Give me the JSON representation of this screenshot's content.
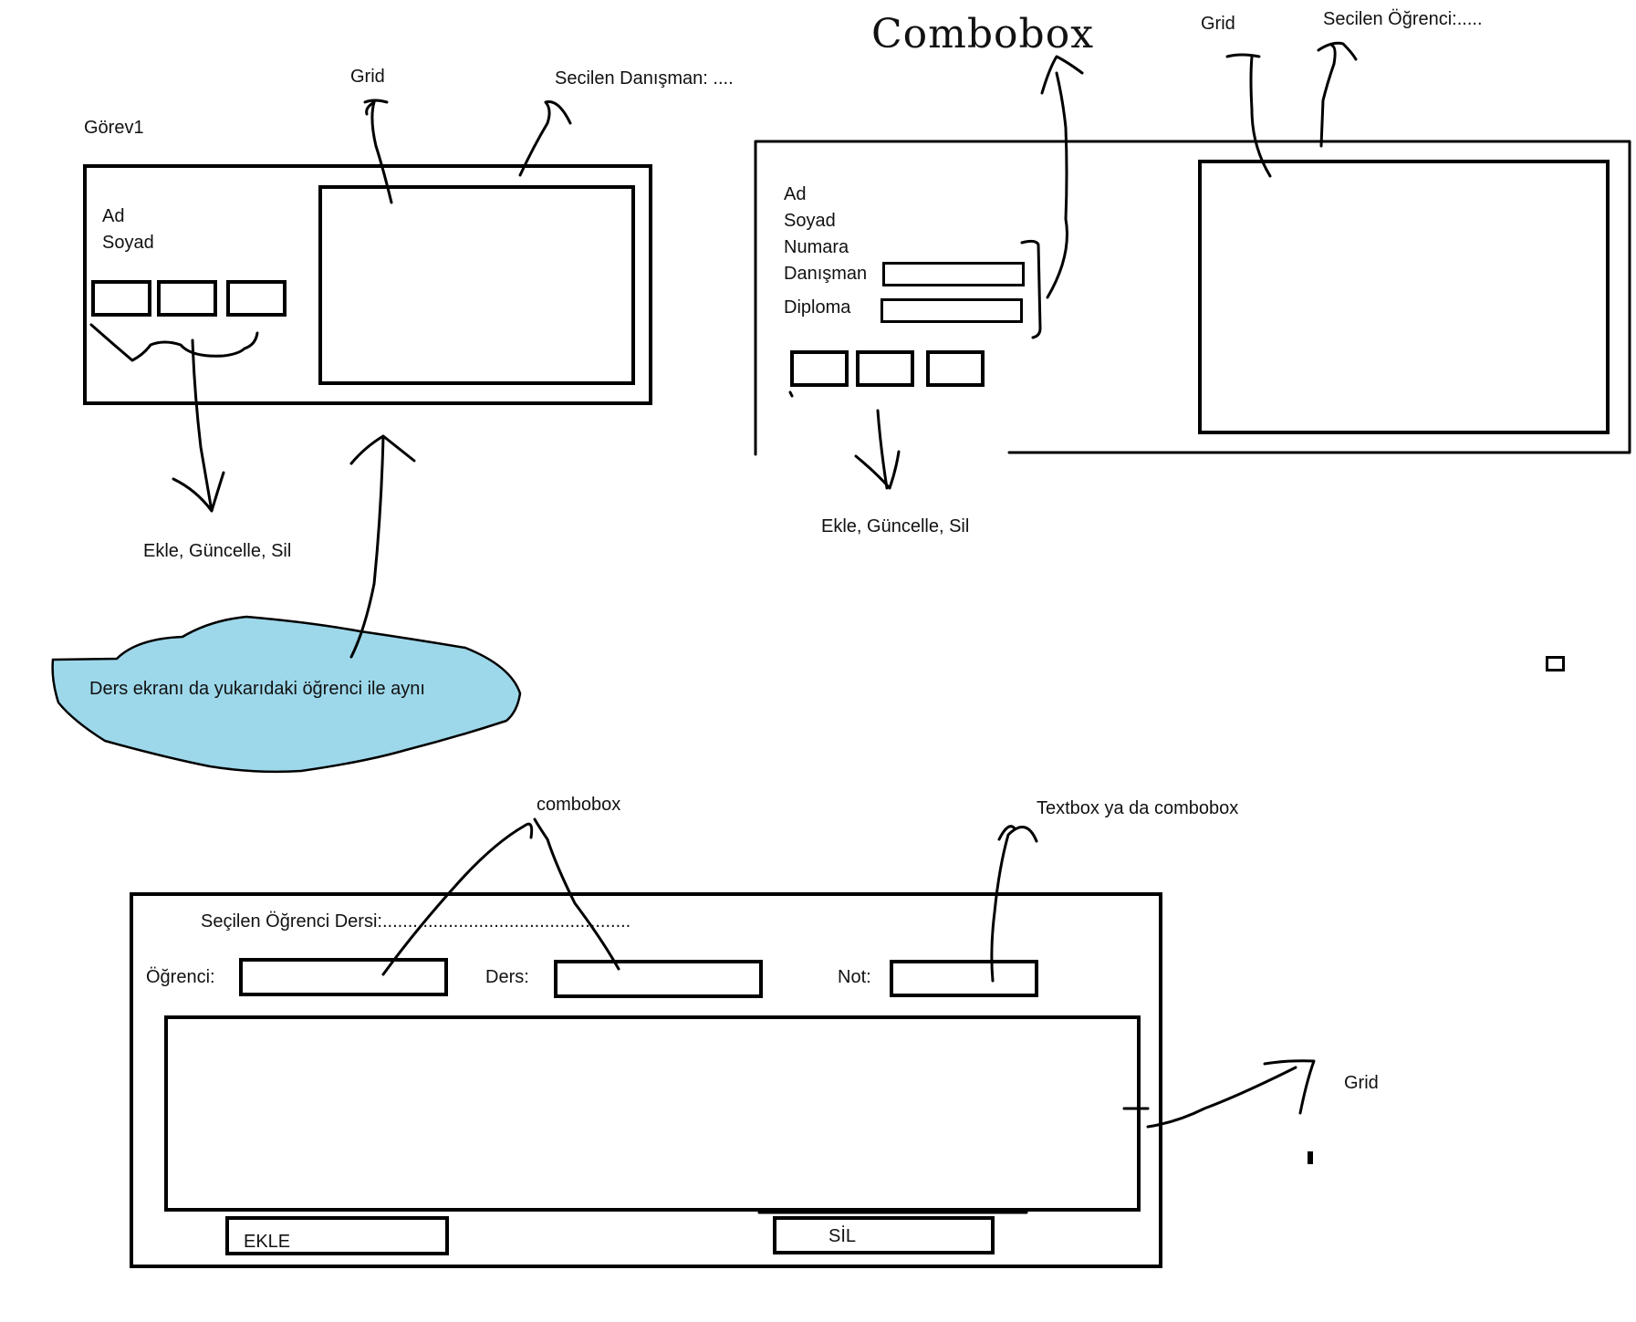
{
  "panel1": {
    "title": "Görev1",
    "label_ad": "Ad",
    "label_soyad": "Soyad",
    "grid_note": "Grid",
    "selected_note": "Secilen Danışman: ....",
    "buttons_note": "Ekle, Güncelle, Sil",
    "cloud_note": "Ders ekranı da yukarıdaki öğrenci ile aynı"
  },
  "panel2": {
    "combobox_note": "Combobox",
    "grid_note": "Grid",
    "selected_note": "Secilen Öğrenci:.....",
    "label_ad": "Ad",
    "label_soyad": "Soyad",
    "label_numara": "Numara",
    "label_danisman": "Danışman",
    "label_diploma": "Diploma",
    "buttons_note": "Ekle, Güncelle, Sil"
  },
  "panel3": {
    "combobox_note": "combobox",
    "textbox_note": "Textbox ya da combobox",
    "selected_label": "Seçilen Öğrenci Dersi:.................................................",
    "label_ogrenci": "Öğrenci:",
    "label_ders": "Ders:",
    "label_not": "Not:",
    "grid_note": "Grid",
    "add_button": "EKLE",
    "delete_button": "SİL"
  },
  "colors": {
    "ink": "#000000",
    "cloud": "#9dd8ea"
  }
}
